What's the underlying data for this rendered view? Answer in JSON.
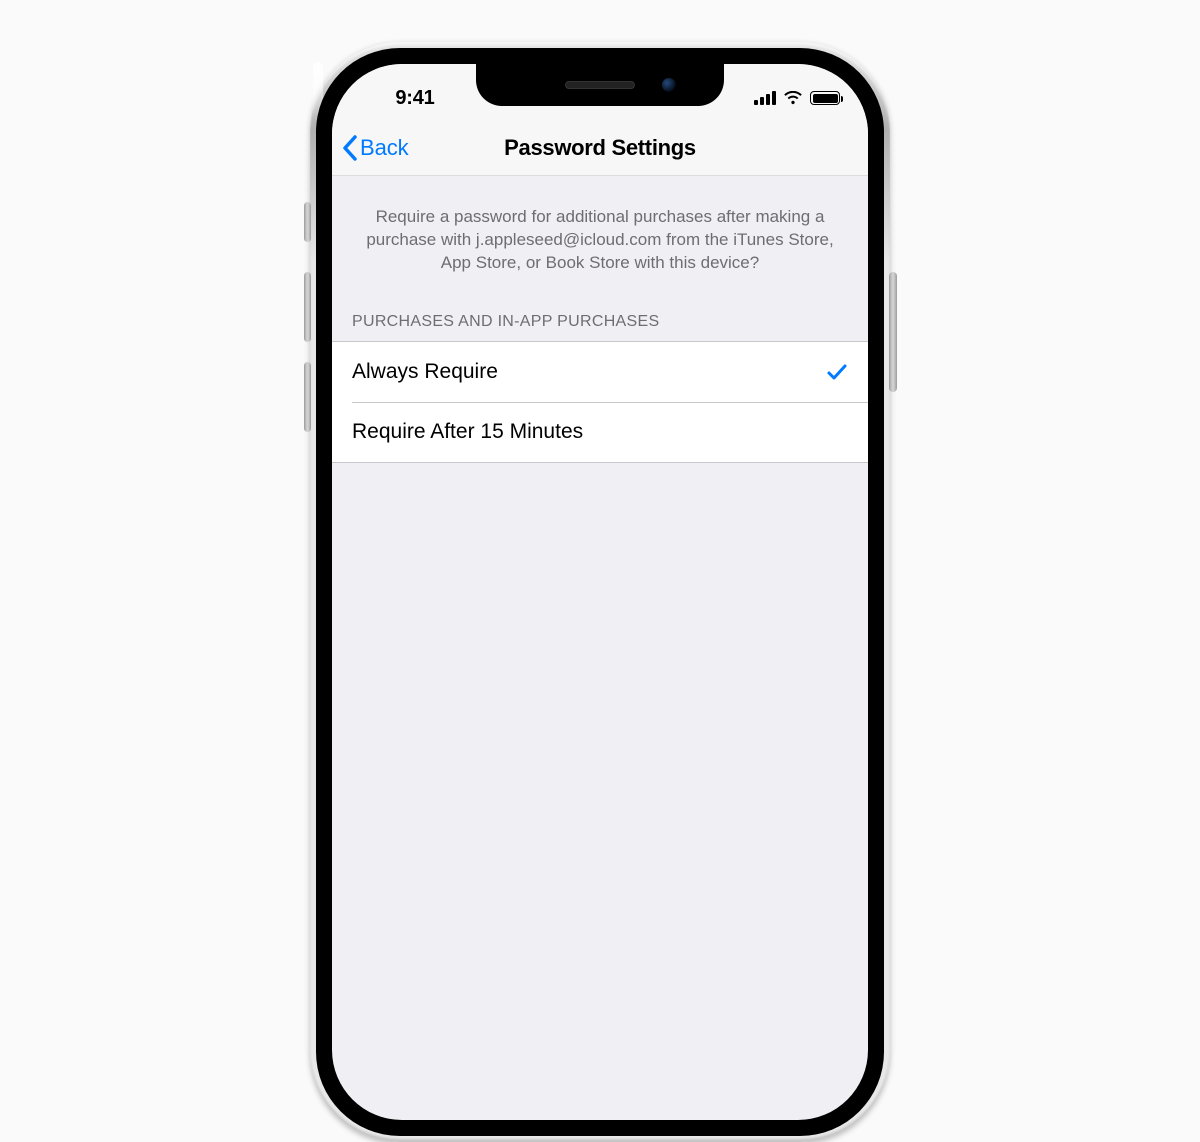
{
  "status": {
    "time": "9:41"
  },
  "nav": {
    "back_label": "Back",
    "title": "Password Settings"
  },
  "header_text": "Require a password for additional purchases after making a purchase with j.appleseed@icloud.com from the iTunes Store, App Store, or Book Store with this device?",
  "section_title": "PURCHASES AND IN-APP PURCHASES",
  "options": [
    {
      "label": "Always Require",
      "selected": true
    },
    {
      "label": "Require After 15 Minutes",
      "selected": false
    }
  ]
}
